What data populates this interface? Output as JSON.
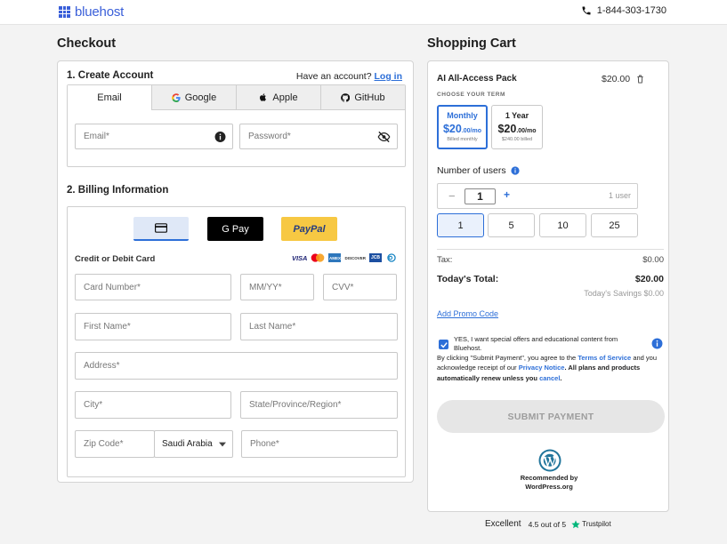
{
  "brand": {
    "name": "bluehost",
    "color": "#3a5fd9"
  },
  "phone": {
    "number": "1-844-303-1730",
    "icon": "phone-icon"
  },
  "checkout": {
    "title": "Checkout",
    "create_account": {
      "title": "1. Create Account",
      "have_account_text": "Have an account?",
      "login_link": "Log in",
      "tabs": [
        {
          "label": "Email",
          "icon": "",
          "active": true
        },
        {
          "label": "Google",
          "icon": "google-icon",
          "active": false
        },
        {
          "label": "Apple",
          "icon": "apple-icon",
          "active": false
        },
        {
          "label": "GitHub",
          "icon": "github-icon",
          "active": false
        }
      ],
      "email_placeholder": "Email*",
      "password_placeholder": "Password*"
    },
    "billing": {
      "title": "2. Billing Information",
      "payment_methods": [
        "card-icon",
        "G Pay",
        "PayPal"
      ],
      "credit_label": "Credit or Debit Card",
      "card_brands": [
        "VISA",
        "mastercard-icon",
        "AMEX",
        "DISCOVER",
        "JCB",
        "diners-icon"
      ],
      "card_number": "Card Number*",
      "expiry": "MM/YY*",
      "cvv": "CVV*",
      "first_name": "First Name*",
      "last_name": "Last Name*",
      "address": "Address*",
      "city": "City*",
      "state": "State/Province/Region*",
      "zip": "Zip Code*",
      "country": "Saudi Arabia",
      "phone": "Phone*"
    }
  },
  "cart": {
    "title": "Shopping Cart",
    "item_name": "AI All-Access Pack",
    "item_price": "$20.00",
    "choose_term": "CHOOSE YOUR TERM",
    "terms": [
      {
        "label": "Monthly",
        "price": "$20",
        "cents": ".00/mo",
        "note": "Billed monthly",
        "selected": true
      },
      {
        "label": "1 Year",
        "price": "$20",
        "cents": ".00/mo",
        "note": "$240.00 billed",
        "selected": false
      }
    ],
    "users_label": "Number of users",
    "qty_minus": "−",
    "qty_value": "1",
    "qty_plus": "+",
    "qty_unit": "1 user",
    "quick_qty": [
      "1",
      "5",
      "10",
      "25"
    ],
    "tax_label": "Tax:",
    "tax_value": "$0.00",
    "total_label": "Today's Total:",
    "total_value": "$20.00",
    "savings": "Today's Savings $0.00",
    "promo": "Add Promo Code",
    "consent_text": "YES, I want special offers and educational content from Bluehost.",
    "legal_1": "By clicking \"Submit Payment\", you agree to the",
    "tos": "Terms of Service",
    "legal_2": "and you acknowledge receipt of our",
    "privacy": "Privacy Notice",
    "legal_3": ". All plans and products automatically renew unless you",
    "cancel": "cancel",
    "submit": "SUBMIT PAYMENT",
    "wp_line1": "Recommended by",
    "wp_line2": "WordPress.org"
  },
  "trust": {
    "excellent": "Excellent",
    "rating": "4.5 out of 5",
    "brand": "Trustpilot"
  },
  "colors": {
    "accent": "#2d6fd8",
    "paypal": "#f7c843",
    "trust_green": "#00b67a"
  }
}
